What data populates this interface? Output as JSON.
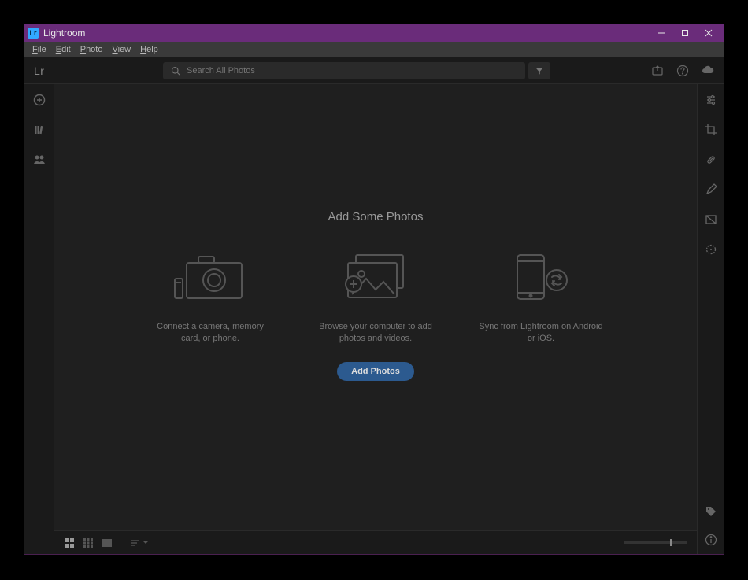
{
  "window": {
    "title": "Lightroom"
  },
  "menu": {
    "file": "File",
    "edit": "Edit",
    "photo": "Photo",
    "view": "View",
    "help": "Help"
  },
  "toolbar": {
    "logo": "Lr",
    "search_placeholder": "Search All Photos"
  },
  "sidebar_left": {
    "add": "add",
    "library": "library",
    "people": "people"
  },
  "empty": {
    "title": "Add Some Photos",
    "cards": [
      {
        "text": "Connect a camera, memory card, or phone."
      },
      {
        "text": "Browse your computer to add photos and videos."
      },
      {
        "text": "Sync from Lightroom on Android or iOS."
      }
    ],
    "add_button": "Add Photos"
  },
  "colors": {
    "accent": "#2c5a8f",
    "titlebar": "#6a2c7a"
  }
}
